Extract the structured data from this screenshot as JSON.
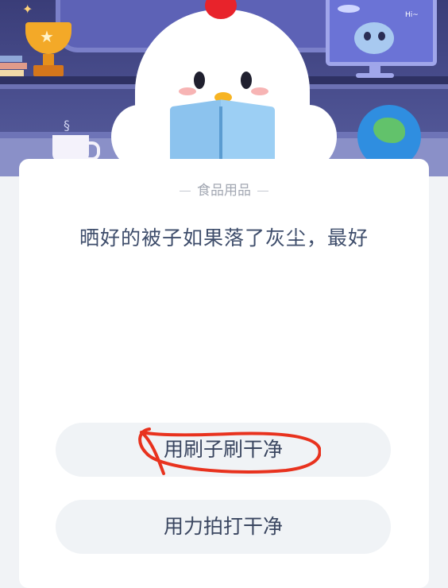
{
  "banner": {
    "hi_text": "Hi~"
  },
  "quiz": {
    "category": "食品用品",
    "question": "晒好的被子如果落了灰尘，最好",
    "options": [
      {
        "label": "用刷子刷干净",
        "annotated": true
      },
      {
        "label": "用力拍打干净",
        "annotated": false
      }
    ]
  },
  "colors": {
    "accent_annotation": "#e8321e",
    "banner_bg": "#3a3d78",
    "option_bg": "#f0f3f6",
    "question_text": "#3e4d6b"
  },
  "icons": [
    "trophy-icon",
    "star-icon",
    "globe-icon",
    "mug-icon",
    "alien-icon",
    "ufo-icon",
    "chick-mascot-icon",
    "book-icon"
  ]
}
